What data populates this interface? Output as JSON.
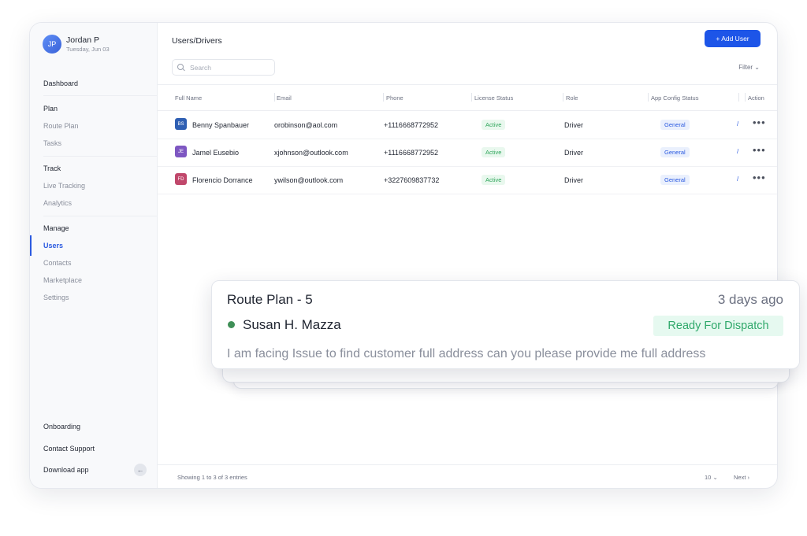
{
  "user": {
    "initials": "JP",
    "name": "Jordan P",
    "date": "Tuesday, Jun 03"
  },
  "sidebar": {
    "dashboard": "Dashboard",
    "sections": [
      {
        "title": "Plan",
        "items": [
          "Route Plan",
          "Tasks"
        ]
      },
      {
        "title": "Track",
        "items": [
          "Live Tracking",
          "Analytics"
        ]
      },
      {
        "title": "Manage",
        "items": [
          "Users",
          "Contacts",
          "Marketplace",
          "Settings"
        ]
      }
    ],
    "active_item": "Users",
    "bottom": [
      "Onboarding",
      "Contact Support",
      "Download app"
    ],
    "collapse_icon": "arrow-left-icon"
  },
  "main": {
    "title": "Users/Drivers",
    "add_button": "+ Add User",
    "search_placeholder": "Search",
    "filter_label": "Filter",
    "columns": [
      "Full Name",
      "Email",
      "Phone",
      "License Status",
      "Role",
      "App Config Status",
      "Action"
    ],
    "rows": [
      {
        "initials": "BS",
        "color": "#2f5fb3",
        "name": "Benny Spanbauer",
        "email": "orobinson@aol.com",
        "phone": "+1116668772952",
        "license": "Active",
        "role": "Driver",
        "config": "General"
      },
      {
        "initials": "JE",
        "color": "#7e57c2",
        "name": "Jamel Eusebio",
        "email": "xjohnson@outlook.com",
        "phone": "+1116668772952",
        "license": "Active",
        "role": "Driver",
        "config": "General"
      },
      {
        "initials": "FD",
        "color": "#c0476b",
        "name": "Florencio Dorrance",
        "email": "ywilson@outlook.com",
        "phone": "+3227609837732",
        "license": "Active",
        "role": "Driver",
        "config": "General"
      }
    ],
    "footer": {
      "info": "Showing 1 to 3 of 3 entries",
      "page_size": "10",
      "next": "Next"
    }
  },
  "notification": {
    "title": "Route Plan - 5",
    "time": "3 days ago",
    "person": "Susan H. Mazza",
    "status": "Ready For Dispatch",
    "message": "I am facing Issue to find customer full address can you please provide me full address"
  },
  "colors": {
    "accent": "#1d55e8",
    "active_green": "#2fa55b",
    "dispatch_green": "#2fa86a"
  }
}
